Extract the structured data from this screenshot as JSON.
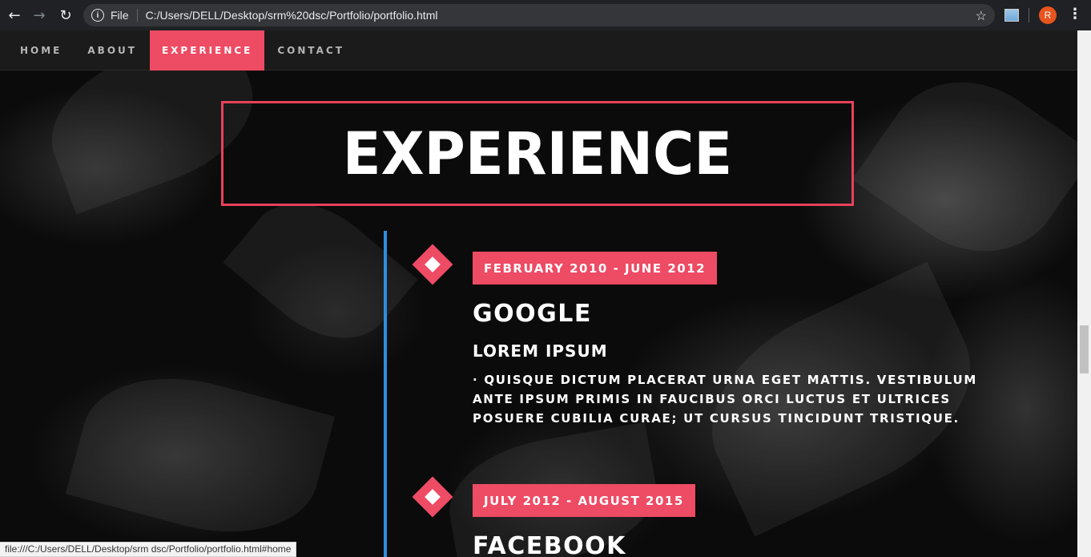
{
  "browser": {
    "protocol_label": "File",
    "url": "C:/Users/DELL/Desktop/srm%20dsc/Portfolio/portfolio.html",
    "profile_initial": "R",
    "status_url": "file:///C:/Users/DELL/Desktop/srm dsc/Portfolio/portfolio.html#home"
  },
  "nav": {
    "items": [
      {
        "label": "HOME",
        "active": false
      },
      {
        "label": "ABOUT",
        "active": false
      },
      {
        "label": "EXPERIENCE",
        "active": true
      },
      {
        "label": "CONTACT",
        "active": false
      }
    ]
  },
  "section": {
    "title": "EXPERIENCE"
  },
  "timeline": [
    {
      "date": "FEBRUARY 2010 - JUNE 2012",
      "company": "GOOGLE",
      "role": "LOREM IPSUM",
      "description": "· QUISQUE DICTUM PLACERAT URNA EGET MATTIS. VESTIBULUM ANTE IPSUM PRIMIS IN FAUCIBUS ORCI LUCTUS ET ULTRICES POSUERE CUBILIA CURAE; UT CURSUS TINCIDUNT TRISTIQUE."
    },
    {
      "date": "JULY 2012 - AUGUST 2015",
      "company": "FACEBOOK"
    }
  ],
  "colors": {
    "accent": "#ee4b64",
    "timeline_line": "#2d8fe0",
    "nav_bg": "#1b1b1b",
    "chrome_bg": "#202124"
  }
}
